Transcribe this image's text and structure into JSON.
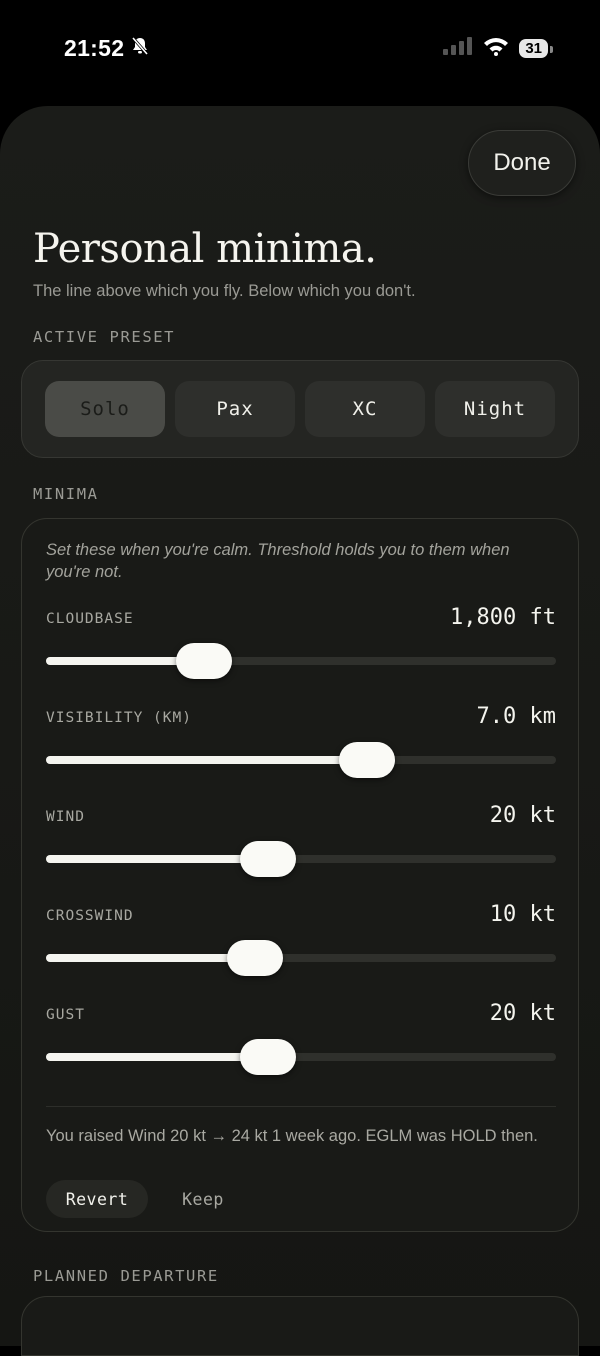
{
  "status": {
    "time": "21:52",
    "battery": "31"
  },
  "sheet": {
    "done_label": "Done",
    "title": "Personal minima.",
    "subtitle": "The line above which you fly. Below which you don't."
  },
  "preset": {
    "section_label": "ACTIVE PRESET",
    "options": [
      "Solo",
      "Pax",
      "XC",
      "Night"
    ],
    "selected": "Solo"
  },
  "minima": {
    "section_label": "MINIMA",
    "note": "Set these when you're calm. Threshold holds you to them when you're not.",
    "sliders": [
      {
        "label": "CLOUDBASE",
        "value": "1,800 ft",
        "fraction": 0.31
      },
      {
        "label": "VISIBILITY (KM)",
        "value": "7.0 km",
        "fraction": 0.63
      },
      {
        "label": "WIND",
        "value": "20 kt",
        "fraction": 0.435
      },
      {
        "label": "CROSSWIND",
        "value": "10 kt",
        "fraction": 0.41
      },
      {
        "label": "GUST",
        "value": "20 kt",
        "fraction": 0.435
      }
    ],
    "change_note": "You raised Wind 20 kt → 24 kt 1 week ago. EGLM was HOLD then.",
    "revert_label": "Revert",
    "keep_label": "Keep"
  },
  "departure": {
    "section_label": "PLANNED DEPARTURE"
  },
  "icons": {
    "bell": "bell-slash-icon",
    "signal": "signal-icon",
    "wifi": "wifi-icon",
    "battery": "battery-icon"
  }
}
